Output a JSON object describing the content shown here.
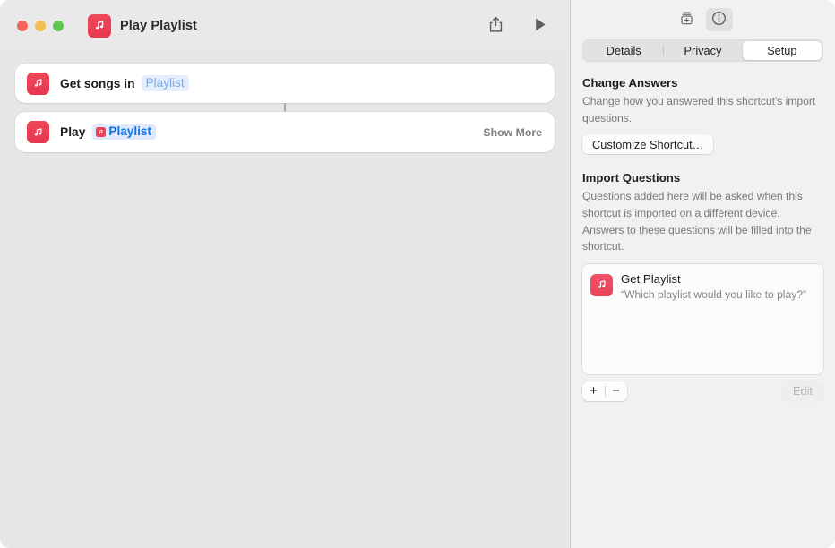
{
  "window": {
    "title": "Play Playlist",
    "app_icon": "music-note-icon",
    "traffic_lights": {
      "close": "close-window-button",
      "minimize": "minimize-window-button",
      "maximize": "maximize-window-button"
    },
    "toolbar": {
      "share_label": "share-icon",
      "run_label": "play-icon"
    }
  },
  "editor": {
    "actions": [
      {
        "icon": "music-note-icon",
        "text": "Get songs in",
        "token": {
          "label": "Playlist",
          "type": "placeholder"
        },
        "trailing": ""
      },
      {
        "icon": "music-note-icon",
        "text": "Play",
        "token": {
          "label": "Playlist",
          "type": "variable",
          "glyph": "music-note-icon"
        },
        "trailing": "Show More"
      }
    ]
  },
  "inspector": {
    "toolbar": {
      "shortcut_details_icon": "add-to-shortcuts-icon",
      "info_icon": "info-circle-icon"
    },
    "tabs": [
      {
        "label": "Details",
        "selected": false
      },
      {
        "label": "Privacy",
        "selected": false
      },
      {
        "label": "Setup",
        "selected": true
      }
    ],
    "change_answers": {
      "heading": "Change Answers",
      "description": "Change how you answered this shortcut's import questions.",
      "button_label": "Customize Shortcut…"
    },
    "import_questions": {
      "heading": "Import Questions",
      "description": "Questions added here will be asked when this shortcut is imported on a different device. Answers to these questions will be filled into the shortcut.",
      "items": [
        {
          "icon": "music-note-icon",
          "title": "Get Playlist",
          "prompt": "“Which playlist would you like to play?”"
        }
      ],
      "footer": {
        "add_label": "+",
        "remove_label": "−",
        "edit_label": "Edit"
      }
    }
  },
  "colors": {
    "accent_red": "#ee4257",
    "token_blue": "#1272e8",
    "placeholder_blue": "#7ba9e8",
    "editor_bg": "#e6e6e6",
    "inspector_bg": "#f1f1f1"
  }
}
